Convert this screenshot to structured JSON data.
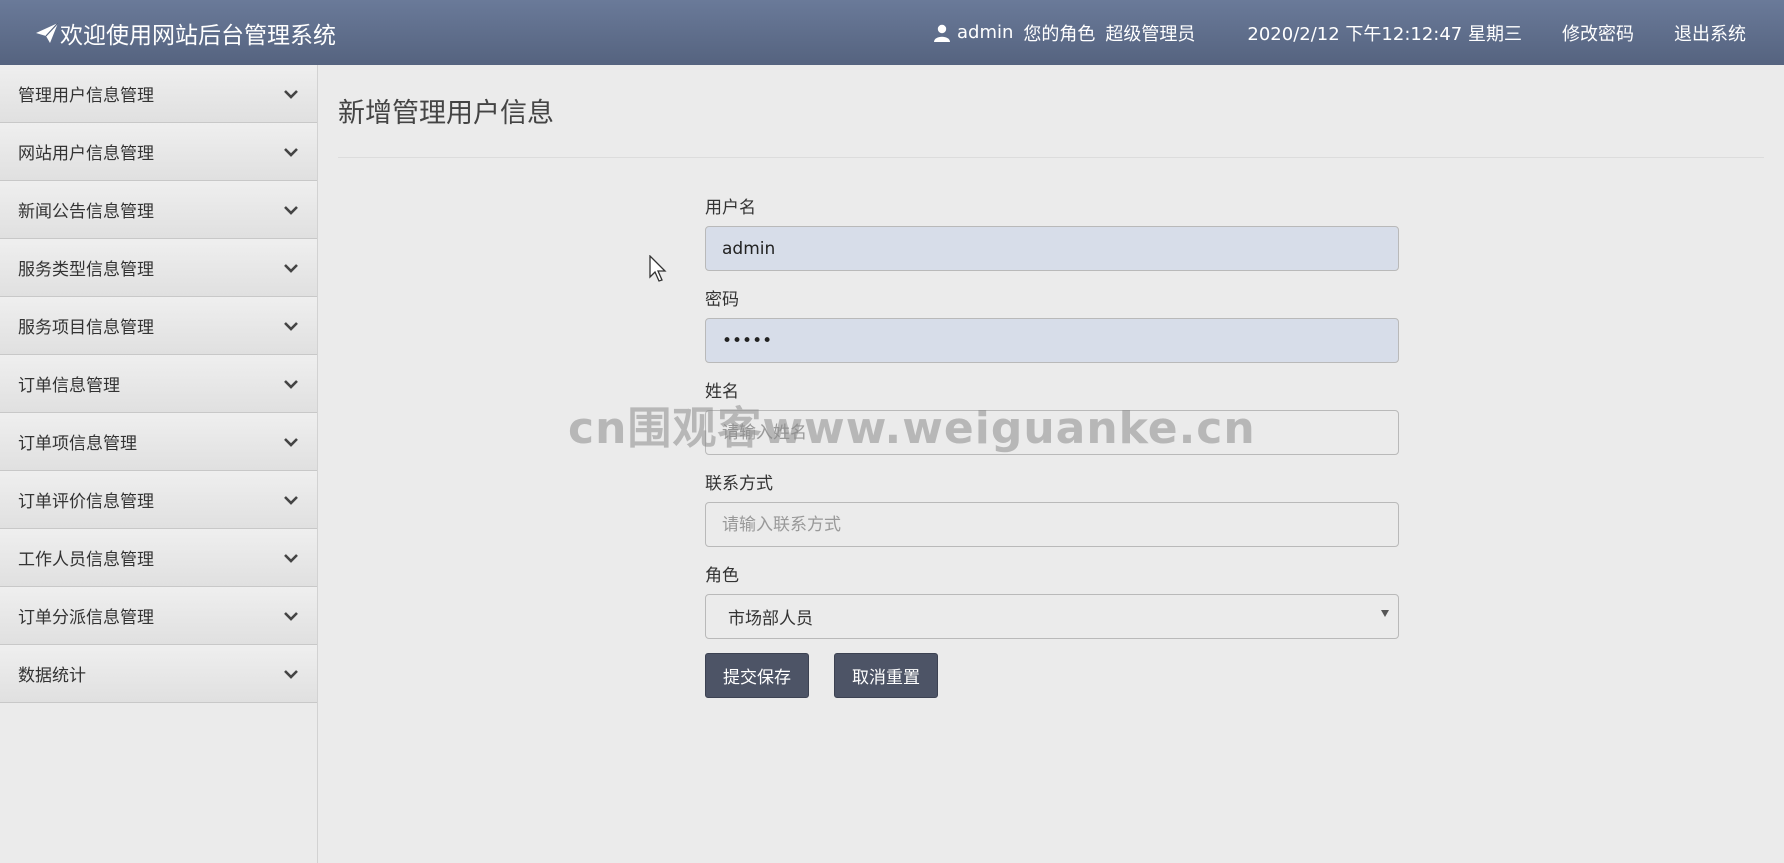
{
  "header": {
    "title": "欢迎使用网站后台管理系统",
    "username": "admin",
    "role_label": "您的角色",
    "role_value": "超级管理员",
    "datetime": "2020/2/12 下午12:12:47 星期三",
    "change_password": "修改密码",
    "logout": "退出系统"
  },
  "sidebar": {
    "items": [
      {
        "label": "管理用户信息管理"
      },
      {
        "label": "网站用户信息管理"
      },
      {
        "label": "新闻公告信息管理"
      },
      {
        "label": "服务类型信息管理"
      },
      {
        "label": "服务项目信息管理"
      },
      {
        "label": "订单信息管理"
      },
      {
        "label": "订单项信息管理"
      },
      {
        "label": "订单评价信息管理"
      },
      {
        "label": "工作人员信息管理"
      },
      {
        "label": "订单分派信息管理"
      },
      {
        "label": "数据统计"
      }
    ]
  },
  "main": {
    "page_title": "新增管理用户信息",
    "form": {
      "username_label": "用户名",
      "username_value": "admin",
      "password_label": "密码",
      "password_value": "•••••",
      "name_label": "姓名",
      "name_placeholder": "请输入姓名",
      "contact_label": "联系方式",
      "contact_placeholder": "请输入联系方式",
      "role_label": "角色",
      "role_value": "市场部人员",
      "submit_label": "提交保存",
      "reset_label": "取消重置"
    }
  },
  "watermark": "cn围观客www.weiguanke.cn"
}
